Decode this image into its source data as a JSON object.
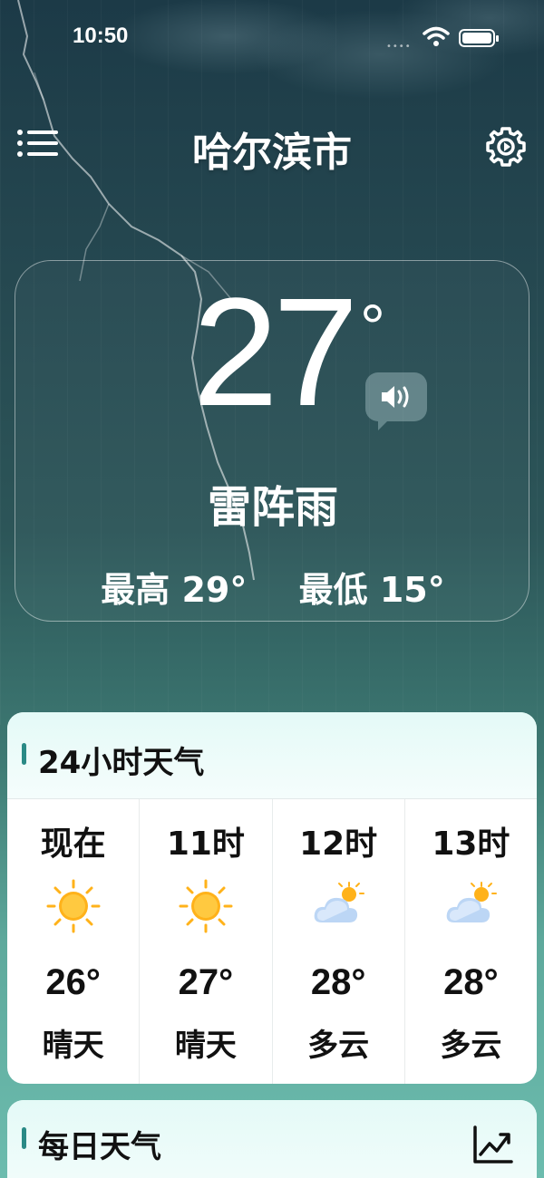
{
  "status": {
    "time": "10:50"
  },
  "header": {
    "city": "哈尔滨市"
  },
  "current": {
    "temp": "27",
    "deg": "°",
    "condition": "雷阵雨",
    "high": "最高 29°",
    "low": "最低 15°"
  },
  "hourly": {
    "title": "24小时天气",
    "items": [
      {
        "label": "现在",
        "icon": "sun-icon",
        "temp": "26°",
        "cond": "晴天"
      },
      {
        "label": "11时",
        "icon": "sun-icon",
        "temp": "27°",
        "cond": "晴天"
      },
      {
        "label": "12时",
        "icon": "partly-cloudy-icon",
        "temp": "28°",
        "cond": "多云"
      },
      {
        "label": "13时",
        "icon": "partly-cloudy-icon",
        "temp": "28°",
        "cond": "多云"
      }
    ]
  },
  "daily": {
    "title": "每日天气"
  },
  "colors": {
    "accent": "#2a8a86",
    "sun": "#ffb21a"
  }
}
